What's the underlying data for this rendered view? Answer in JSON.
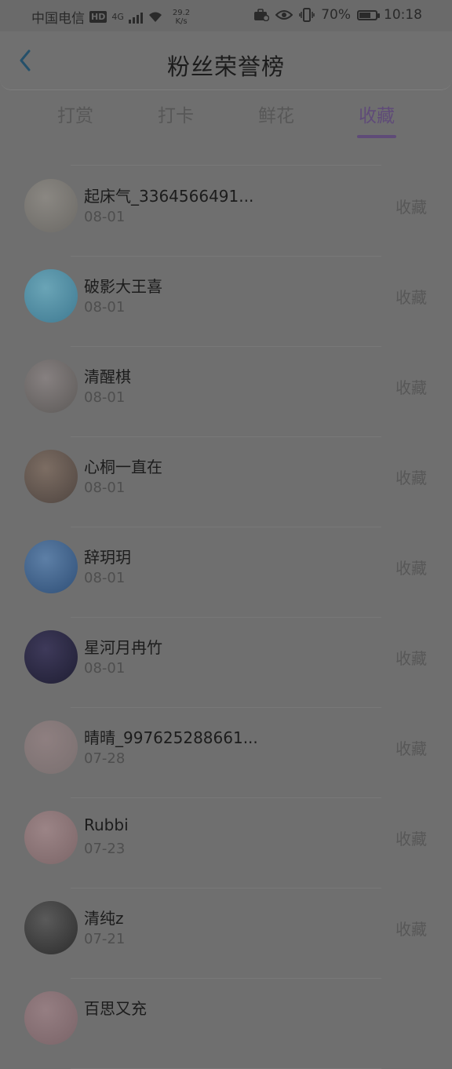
{
  "status_bar": {
    "carrier": "中国电信",
    "hd": "HD",
    "network": "4G",
    "speed_value": "29.2",
    "speed_unit": "K/s",
    "battery": "70%",
    "battery_level": 0.7,
    "time": "10:18"
  },
  "header": {
    "title": "粉丝荣誉榜"
  },
  "tabs": [
    {
      "label": "打赏",
      "active": false
    },
    {
      "label": "打卡",
      "active": false
    },
    {
      "label": "鲜花",
      "active": false
    },
    {
      "label": "收藏",
      "active": true
    }
  ],
  "list": [
    {
      "name": "起床气_3364566491...",
      "date": "08-01",
      "action": "收藏",
      "avatar_colors": [
        "#6c6a66",
        "#8a8782"
      ]
    },
    {
      "name": "破影大王喜",
      "date": "08-01",
      "action": "收藏",
      "avatar_colors": [
        "#3f7a92",
        "#6aa4b6"
      ]
    },
    {
      "name": "清醒棋",
      "date": "08-01",
      "action": "收藏",
      "avatar_colors": [
        "#5d5a58",
        "#868080"
      ]
    },
    {
      "name": "心桐一直在",
      "date": "08-01",
      "action": "收藏",
      "avatar_colors": [
        "#4f4540",
        "#7c6d63"
      ]
    },
    {
      "name": "辞玥玥",
      "date": "08-01",
      "action": "收藏",
      "avatar_colors": [
        "#2f4f77",
        "#5d7fa6"
      ]
    },
    {
      "name": "星河月冉竹",
      "date": "08-01",
      "action": "收藏",
      "avatar_colors": [
        "#1f1e33",
        "#3e3a5a"
      ]
    },
    {
      "name": "晴晴_997625288661...",
      "date": "07-28",
      "action": "收藏",
      "avatar_colors": [
        "#7a7070",
        "#8e7f80"
      ]
    },
    {
      "name": "Rubbi",
      "date": "07-23",
      "action": "收藏",
      "avatar_colors": [
        "#7c6668",
        "#9b8486"
      ]
    },
    {
      "name": "清纯z",
      "date": "07-21",
      "action": "收藏",
      "avatar_colors": [
        "#2c2c2c",
        "#5a5a5a"
      ]
    },
    {
      "name": "百思又充",
      "date": "",
      "action": "",
      "avatar_colors": [
        "#7a6468",
        "#957e82"
      ]
    }
  ]
}
